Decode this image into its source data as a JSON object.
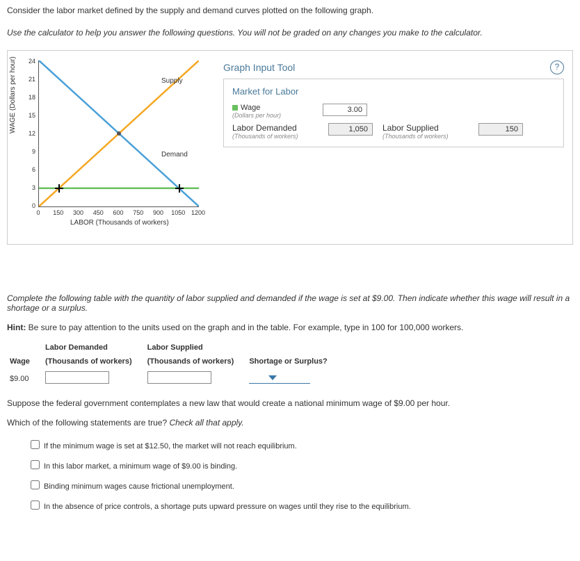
{
  "intro1": "Consider the labor market defined by the supply and demand curves plotted on the following graph.",
  "intro2": "Use the calculator to help you answer the following questions. You will not be graded on any changes you make to the calculator.",
  "chart_data": {
    "type": "line",
    "xlabel": "LABOR (Thousands of workers)",
    "ylabel": "WAGE (Dollars per hour)",
    "xlim": [
      0,
      1200
    ],
    "ylim": [
      0,
      24
    ],
    "x_ticks": [
      0,
      150,
      300,
      450,
      600,
      750,
      900,
      1050,
      1200
    ],
    "y_ticks": [
      0,
      3,
      6,
      9,
      12,
      15,
      18,
      21,
      24
    ],
    "series": [
      {
        "name": "Supply",
        "color": "#f5a721",
        "points": [
          [
            0,
            0
          ],
          [
            1200,
            24
          ]
        ]
      },
      {
        "name": "Demand",
        "color": "#4aa0d8",
        "points": [
          [
            0,
            24
          ],
          [
            1200,
            0
          ]
        ]
      },
      {
        "name": "Wage line",
        "color": "#6ac060",
        "points": [
          [
            0,
            3
          ],
          [
            1200,
            3
          ]
        ]
      }
    ],
    "intersection": {
      "labor": 600,
      "wage": 12
    },
    "labels": {
      "supply": "Supply",
      "demand": "Demand"
    }
  },
  "tool": {
    "title": "Graph Input Tool",
    "panel_title": "Market for Labor",
    "wage_label": "Wage",
    "wage_sub": "(Dollars per hour)",
    "wage_value": "3.00",
    "demand_label": "Labor Demanded",
    "demand_sub": "(Thousands of workers)",
    "demand_value": "1,050",
    "supply_label": "Labor Supplied",
    "supply_sub": "(Thousands of workers)",
    "supply_value": "150",
    "help": "?"
  },
  "q1": {
    "prompt_a": "Complete the following table with the quantity of labor supplied and demanded if the wage is set at $9.00. Then indicate whether this wage will result in a shortage or a surplus.",
    "hint_label": "Hint:",
    "hint_text": " Be sure to pay attention to the units used on the graph and in the table. For example, type in 100 for 100,000 workers.",
    "col_wage": "Wage",
    "col_ld": "Labor Demanded",
    "col_ld_sub": "(Thousands of workers)",
    "col_ls": "Labor Supplied",
    "col_ls_sub": "(Thousands of workers)",
    "col_ss": "Shortage or Surplus?",
    "row_wage": "$9.00"
  },
  "q2": {
    "prompt": "Suppose the federal government contemplates a new law that would create a national minimum wage of $9.00 per hour.",
    "which": "Which of the following statements are true?",
    "which_instr": " Check all that apply.",
    "opts": [
      "If the minimum wage is set at $12.50, the market will not reach equilibrium.",
      "In this labor market, a minimum wage of $9.00 is binding.",
      "Binding minimum wages cause frictional unemployment.",
      "In the absence of price controls, a shortage puts upward pressure on wages until they rise to the equilibrium."
    ]
  }
}
